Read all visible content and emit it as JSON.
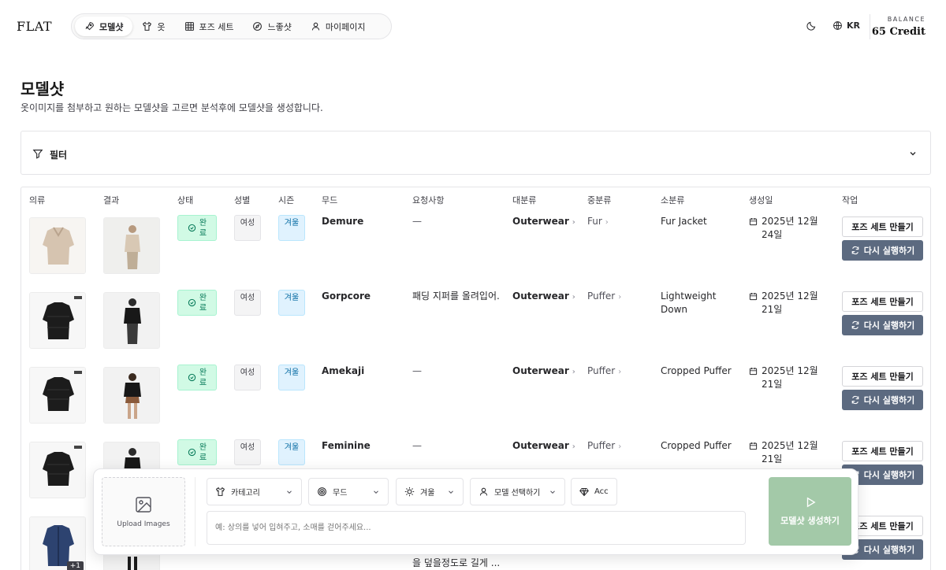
{
  "header": {
    "logo": "FLAT",
    "nav": [
      {
        "label": "모델샷",
        "icon": "rocket-icon",
        "active": true
      },
      {
        "label": "옷",
        "icon": "shirt-icon",
        "active": false
      },
      {
        "label": "포즈 세트",
        "icon": "grid-icon",
        "active": false
      },
      {
        "label": "느좋샷",
        "icon": "compass-icon",
        "active": false
      },
      {
        "label": "마이페이지",
        "icon": "user-icon",
        "active": false
      }
    ],
    "language": "KR",
    "balance_label": "BALANCE",
    "balance_value": "65 Credit"
  },
  "page": {
    "title": "모델샷",
    "subtitle": "옷이미지를 첨부하고 원하는 모델샷을 고르면 분석후에 모델샷을 생성합니다."
  },
  "filter": {
    "label": "필터"
  },
  "table": {
    "columns": [
      "의류",
      "결과",
      "상태",
      "성별",
      "시즌",
      "무드",
      "요청사항",
      "대분류",
      "중분류",
      "소분류",
      "생성일",
      "작업"
    ],
    "pose_button": "포즈 세트 만들기",
    "rerun_button": "다시 실행하기",
    "rows": [
      {
        "status": "완료",
        "gender": "여성",
        "season": "겨울",
        "mood": "Demure",
        "request": "—",
        "major": "Outerwear",
        "middle": "Fur",
        "minor": "Fur Jacket",
        "date": "2025년 12월 24일"
      },
      {
        "status": "완료",
        "gender": "여성",
        "season": "겨울",
        "mood": "Gorpcore",
        "request": "패딩 지퍼를 올려입어.",
        "major": "Outerwear",
        "middle": "Puffer",
        "minor": "Lightweight Down",
        "date": "2025년 12월 21일"
      },
      {
        "status": "완료",
        "gender": "여성",
        "season": "겨울",
        "mood": "Amekaji",
        "request": "—",
        "major": "Outerwear",
        "middle": "Puffer",
        "minor": "Cropped Puffer",
        "date": "2025년 12월 21일"
      },
      {
        "status": "완료",
        "gender": "여성",
        "season": "겨울",
        "mood": "Feminine",
        "request": "—",
        "major": "Outerwear",
        "middle": "Puffer",
        "minor": "Cropped Puffer",
        "date": "2025년 12월 21일"
      },
      {
        "status": "",
        "gender": "",
        "season": "",
        "mood": "",
        "request": "을 덮을정도로 길게 ...",
        "major": "",
        "middle": "",
        "minor": "",
        "date": "",
        "extra_count": "+1"
      }
    ]
  },
  "composer": {
    "upload_label": "Upload Images",
    "category_label": "카테고리",
    "mood_label": "무드",
    "season_label": "겨울",
    "model_label": "모델 선택하기",
    "acc_label": "Acc",
    "prompt_placeholder": "예: 상의를 넣어 입혀주고, 소매를 걷어주세요...",
    "generate_label": "모델샷 생성하기"
  },
  "colors": {
    "accent_green": "#a3c9a8",
    "status_green_bg": "#d1fae5",
    "season_blue_bg": "#e0f2fe",
    "rerun_bg": "#5c6a80"
  }
}
